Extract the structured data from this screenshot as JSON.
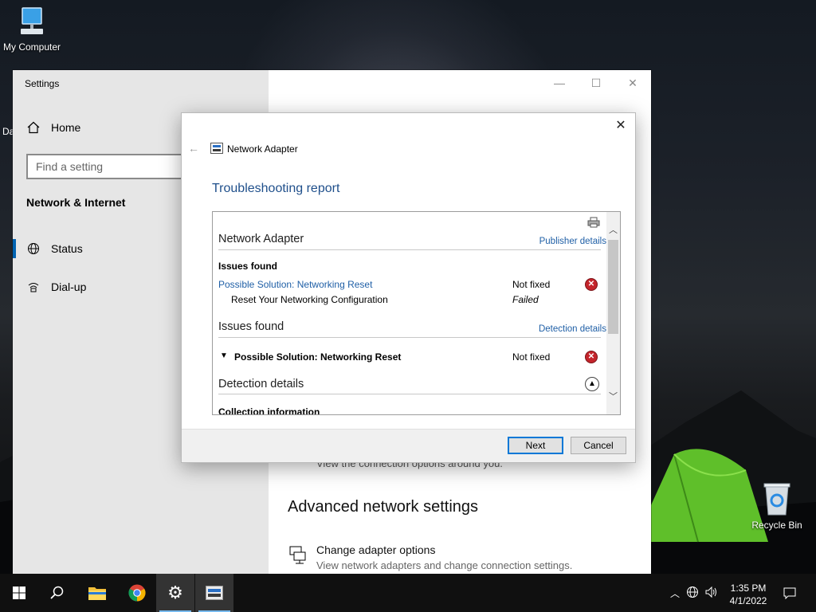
{
  "desktop": {
    "icons": [
      {
        "label": "My Computer",
        "icon": "computer-icon"
      },
      {
        "label": "Recycle Bin",
        "icon": "recycle-bin-icon"
      }
    ],
    "partial_label": "Da"
  },
  "settings": {
    "title": "Settings",
    "home_label": "Home",
    "search_placeholder": "Find a setting",
    "section_title": "Network & Internet",
    "nav": [
      {
        "label": "Status",
        "icon": "globe-icon"
      },
      {
        "label": "Dial-up",
        "icon": "dial-up-icon"
      }
    ],
    "content": {
      "partial_text": "View the connection options around you.",
      "advanced_title": "Advanced network settings",
      "adapter_option_title": "Change adapter options",
      "adapter_option_desc": "View network adapters and change connection settings."
    }
  },
  "dialog": {
    "app_name": "Network Adapter",
    "heading": "Troubleshooting report",
    "report": {
      "section1_title": "Network Adapter",
      "publisher_link": "Publisher details",
      "issues_label": "Issues found",
      "solution_link": "Possible Solution: Networking Reset",
      "solution_status": "Not fixed",
      "sub_item": "Reset Your Networking Configuration",
      "sub_status": "Failed",
      "section2_title": "Issues found",
      "detection_link": "Detection details",
      "solution_bold": "Possible Solution: Networking Reset",
      "solution_bold_status": "Not fixed",
      "section3_title": "Detection details",
      "collection_label": "Collection information"
    },
    "buttons": {
      "next": "Next",
      "cancel": "Cancel"
    }
  },
  "taskbar": {
    "items": [
      "start-icon",
      "search-icon",
      "file-explorer-icon",
      "chrome-icon",
      "settings-icon",
      "troubleshooter-icon"
    ],
    "clock_time": "1:35 PM",
    "clock_date": "4/1/2022"
  }
}
